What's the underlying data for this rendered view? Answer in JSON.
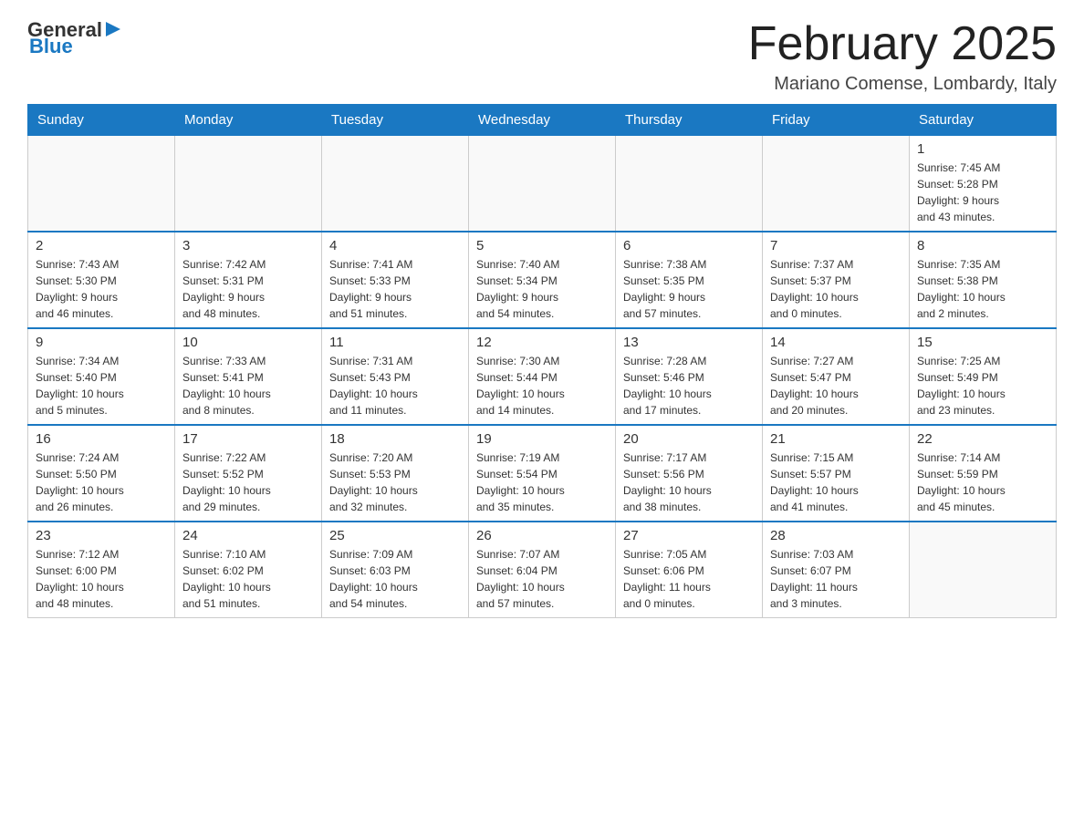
{
  "header": {
    "logo_general": "General",
    "logo_blue": "Blue",
    "month_title": "February 2025",
    "location": "Mariano Comense, Lombardy, Italy"
  },
  "days_of_week": [
    "Sunday",
    "Monday",
    "Tuesday",
    "Wednesday",
    "Thursday",
    "Friday",
    "Saturday"
  ],
  "weeks": [
    [
      {
        "day": "",
        "info": ""
      },
      {
        "day": "",
        "info": ""
      },
      {
        "day": "",
        "info": ""
      },
      {
        "day": "",
        "info": ""
      },
      {
        "day": "",
        "info": ""
      },
      {
        "day": "",
        "info": ""
      },
      {
        "day": "1",
        "info": "Sunrise: 7:45 AM\nSunset: 5:28 PM\nDaylight: 9 hours\nand 43 minutes."
      }
    ],
    [
      {
        "day": "2",
        "info": "Sunrise: 7:43 AM\nSunset: 5:30 PM\nDaylight: 9 hours\nand 46 minutes."
      },
      {
        "day": "3",
        "info": "Sunrise: 7:42 AM\nSunset: 5:31 PM\nDaylight: 9 hours\nand 48 minutes."
      },
      {
        "day": "4",
        "info": "Sunrise: 7:41 AM\nSunset: 5:33 PM\nDaylight: 9 hours\nand 51 minutes."
      },
      {
        "day": "5",
        "info": "Sunrise: 7:40 AM\nSunset: 5:34 PM\nDaylight: 9 hours\nand 54 minutes."
      },
      {
        "day": "6",
        "info": "Sunrise: 7:38 AM\nSunset: 5:35 PM\nDaylight: 9 hours\nand 57 minutes."
      },
      {
        "day": "7",
        "info": "Sunrise: 7:37 AM\nSunset: 5:37 PM\nDaylight: 10 hours\nand 0 minutes."
      },
      {
        "day": "8",
        "info": "Sunrise: 7:35 AM\nSunset: 5:38 PM\nDaylight: 10 hours\nand 2 minutes."
      }
    ],
    [
      {
        "day": "9",
        "info": "Sunrise: 7:34 AM\nSunset: 5:40 PM\nDaylight: 10 hours\nand 5 minutes."
      },
      {
        "day": "10",
        "info": "Sunrise: 7:33 AM\nSunset: 5:41 PM\nDaylight: 10 hours\nand 8 minutes."
      },
      {
        "day": "11",
        "info": "Sunrise: 7:31 AM\nSunset: 5:43 PM\nDaylight: 10 hours\nand 11 minutes."
      },
      {
        "day": "12",
        "info": "Sunrise: 7:30 AM\nSunset: 5:44 PM\nDaylight: 10 hours\nand 14 minutes."
      },
      {
        "day": "13",
        "info": "Sunrise: 7:28 AM\nSunset: 5:46 PM\nDaylight: 10 hours\nand 17 minutes."
      },
      {
        "day": "14",
        "info": "Sunrise: 7:27 AM\nSunset: 5:47 PM\nDaylight: 10 hours\nand 20 minutes."
      },
      {
        "day": "15",
        "info": "Sunrise: 7:25 AM\nSunset: 5:49 PM\nDaylight: 10 hours\nand 23 minutes."
      }
    ],
    [
      {
        "day": "16",
        "info": "Sunrise: 7:24 AM\nSunset: 5:50 PM\nDaylight: 10 hours\nand 26 minutes."
      },
      {
        "day": "17",
        "info": "Sunrise: 7:22 AM\nSunset: 5:52 PM\nDaylight: 10 hours\nand 29 minutes."
      },
      {
        "day": "18",
        "info": "Sunrise: 7:20 AM\nSunset: 5:53 PM\nDaylight: 10 hours\nand 32 minutes."
      },
      {
        "day": "19",
        "info": "Sunrise: 7:19 AM\nSunset: 5:54 PM\nDaylight: 10 hours\nand 35 minutes."
      },
      {
        "day": "20",
        "info": "Sunrise: 7:17 AM\nSunset: 5:56 PM\nDaylight: 10 hours\nand 38 minutes."
      },
      {
        "day": "21",
        "info": "Sunrise: 7:15 AM\nSunset: 5:57 PM\nDaylight: 10 hours\nand 41 minutes."
      },
      {
        "day": "22",
        "info": "Sunrise: 7:14 AM\nSunset: 5:59 PM\nDaylight: 10 hours\nand 45 minutes."
      }
    ],
    [
      {
        "day": "23",
        "info": "Sunrise: 7:12 AM\nSunset: 6:00 PM\nDaylight: 10 hours\nand 48 minutes."
      },
      {
        "day": "24",
        "info": "Sunrise: 7:10 AM\nSunset: 6:02 PM\nDaylight: 10 hours\nand 51 minutes."
      },
      {
        "day": "25",
        "info": "Sunrise: 7:09 AM\nSunset: 6:03 PM\nDaylight: 10 hours\nand 54 minutes."
      },
      {
        "day": "26",
        "info": "Sunrise: 7:07 AM\nSunset: 6:04 PM\nDaylight: 10 hours\nand 57 minutes."
      },
      {
        "day": "27",
        "info": "Sunrise: 7:05 AM\nSunset: 6:06 PM\nDaylight: 11 hours\nand 0 minutes."
      },
      {
        "day": "28",
        "info": "Sunrise: 7:03 AM\nSunset: 6:07 PM\nDaylight: 11 hours\nand 3 minutes."
      },
      {
        "day": "",
        "info": ""
      }
    ]
  ]
}
